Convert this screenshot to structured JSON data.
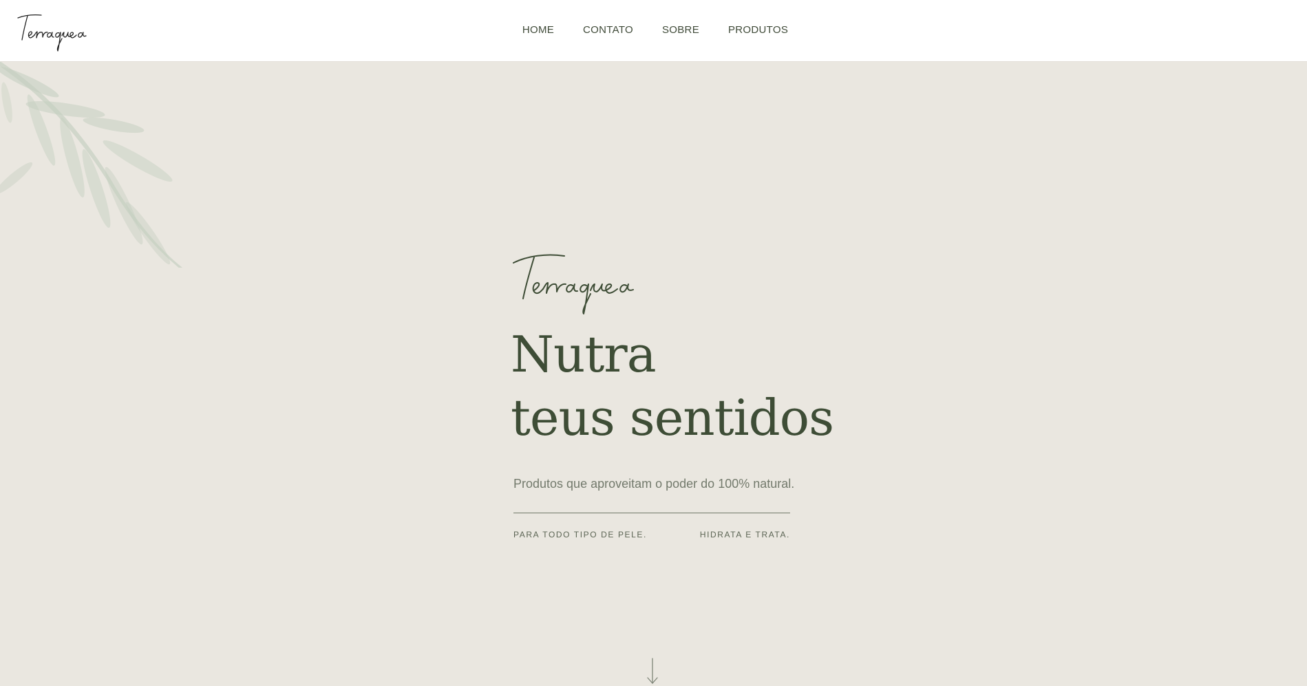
{
  "brand": {
    "name": "Terraquea"
  },
  "nav": {
    "items": [
      {
        "label": "HOME"
      },
      {
        "label": "CONTATO"
      },
      {
        "label": "SOBRE"
      },
      {
        "label": "PRODUTOS"
      }
    ]
  },
  "hero": {
    "headline_line1": "Nutra",
    "headline_line2": "teus sentidos",
    "subtitle": "Produtos que aproveitam o poder do 100% natural.",
    "features": [
      {
        "label": "PARA TODO TIPO DE PELE."
      },
      {
        "label": "HIDRATA E TRATA."
      }
    ]
  },
  "colors": {
    "background": "#eae7e0",
    "header_bg": "#ffffff",
    "accent_dark_green": "#3e4d36",
    "muted_text": "#737a6c",
    "leaf_green": "#a9bda8"
  },
  "icons": {
    "scroll": "arrow-down-icon",
    "decoration": "leaves-icon"
  }
}
